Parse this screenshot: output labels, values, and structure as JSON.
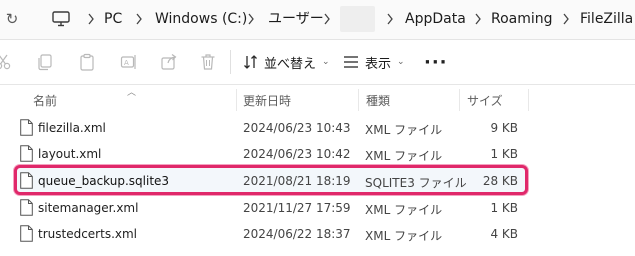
{
  "address_bar": {
    "crumbs": [
      "PC",
      "Windows (C:)",
      "ユーザー",
      "AppData",
      "Roaming",
      "FileZilla"
    ]
  },
  "toolbar": {
    "sort_label": "並べ替え",
    "view_label": "表示",
    "more_label": "···"
  },
  "columns": {
    "name": "名前",
    "modified": "更新日時",
    "type": "種類",
    "size": "サイズ"
  },
  "files": [
    {
      "name": "filezilla.xml",
      "modified": "2024/06/23 10:43",
      "type": "XML ファイル",
      "size": "9 KB",
      "selected": false
    },
    {
      "name": "layout.xml",
      "modified": "2024/06/23 10:42",
      "type": "XML ファイル",
      "size": "1 KB",
      "selected": false
    },
    {
      "name": "queue_backup.sqlite3",
      "modified": "2021/08/21 18:19",
      "type": "SQLITE3 ファイル",
      "size": "28 KB",
      "selected": true
    },
    {
      "name": "sitemanager.xml",
      "modified": "2021/11/27 17:59",
      "type": "XML ファイル",
      "size": "1 KB",
      "selected": false
    },
    {
      "name": "trustedcerts.xml",
      "modified": "2024/06/22 18:37",
      "type": "XML ファイル",
      "size": "4 KB",
      "selected": false
    }
  ],
  "icons": [
    "refresh-icon",
    "pc-icon",
    "cut-icon",
    "copy-icon",
    "paste-icon",
    "rename-icon",
    "share-icon",
    "delete-icon",
    "sort-icon",
    "view-icon",
    "file-icon"
  ],
  "colors": {
    "highlight_border": "#e0286a",
    "accent": "#0067c0"
  }
}
